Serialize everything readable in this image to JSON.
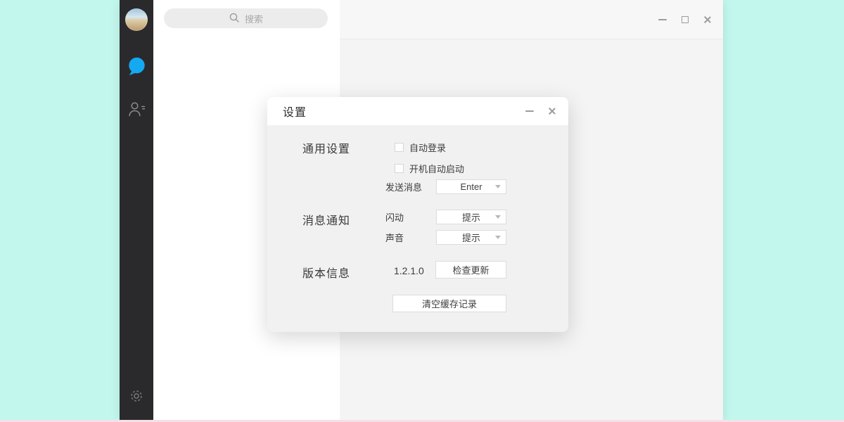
{
  "colors": {
    "desktop": "#c2f7ee",
    "desktop_bottom_strip": "#f6e0e6",
    "sidebar": "#2a2a2c",
    "accent_blue": "#14a9f1",
    "panel": "#ffffff",
    "main_bg": "#f4f4f4",
    "dialog_bg": "#f1f1f1"
  },
  "icons": {
    "search": "magnifier",
    "chat": "speech-bubble",
    "contacts": "person-with-lines",
    "settings": "gear",
    "minimize": "horizontal-bar",
    "maximize": "square-outline",
    "close": "x-cross",
    "dropdown_caret": "triangle-down"
  },
  "search": {
    "placeholder": "搜索"
  },
  "dialog": {
    "title": "设置",
    "general": {
      "label": "通用设置",
      "checkboxes": [
        {
          "label": "自动登录",
          "checked": false
        },
        {
          "label": "开机自动启动",
          "checked": false
        }
      ],
      "send_message": {
        "label": "发送消息",
        "value": "Enter"
      }
    },
    "notifications": {
      "label": "消息通知",
      "flash": {
        "label": "闪动",
        "value": "提示"
      },
      "sound": {
        "label": "声音",
        "value": "提示"
      }
    },
    "version": {
      "label": "版本信息",
      "value": "1.2.1.0",
      "check_update_label": "检查更新"
    },
    "clear_cache_label": "清空缓存记录"
  }
}
